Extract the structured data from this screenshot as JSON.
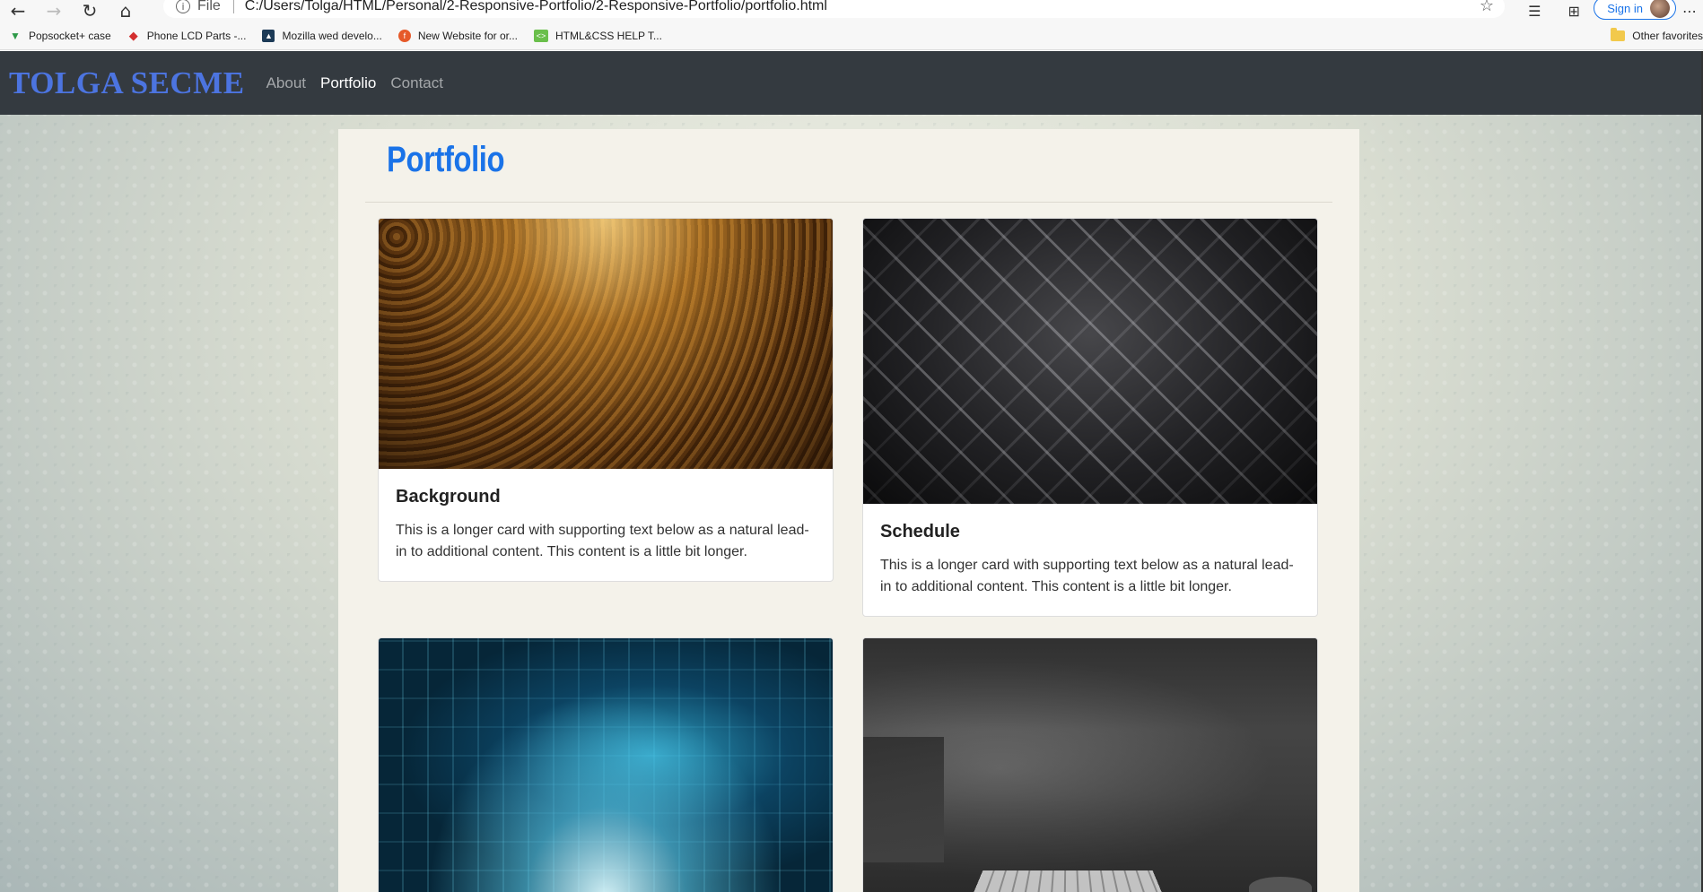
{
  "browser": {
    "file_label": "File",
    "url": "C:/Users/Tolga/HTML/Personal/2-Responsive-Portfolio/2-Responsive-Portfolio/portfolio.html",
    "signin_label": "Sign in",
    "bookmarks": [
      {
        "label": "Popsocket+ case",
        "icon": "v-icon",
        "color": "#2e9a49"
      },
      {
        "label": "Phone LCD Parts -...",
        "icon": "diamond-icon",
        "color": "#d32f2f"
      },
      {
        "label": "Mozilla wed develo...",
        "icon": "mdn-icon",
        "color": "#1c3a57"
      },
      {
        "label": "New Website for or...",
        "icon": "fiverr-icon",
        "color": "#e65a2a"
      },
      {
        "label": "HTML&CSS HELP T...",
        "icon": "html-icon",
        "color": "#6abf4b"
      }
    ],
    "other_favorites": "Other favorites"
  },
  "site": {
    "brand": "TOLGA SECME",
    "nav": [
      {
        "label": "About"
      },
      {
        "label": "Portfolio"
      },
      {
        "label": "Contact"
      }
    ],
    "active_nav": "Portfolio",
    "page_title": "Portfolio",
    "cards": [
      {
        "title": "Background",
        "text": "This is a longer card with supporting text below as a natural lead-in to additional content. This content is a little bit longer."
      },
      {
        "title": "Schedule",
        "text": "This is a longer card with supporting text below as a natural lead-in to additional content. This content is a little bit longer."
      },
      {
        "title": "",
        "text": ""
      },
      {
        "title": "",
        "text": ""
      }
    ]
  },
  "colors": {
    "navbar": "#343a40",
    "brand": "#4c74e0",
    "title_blue": "#1a73e8",
    "panel": "#f4f2ea"
  }
}
